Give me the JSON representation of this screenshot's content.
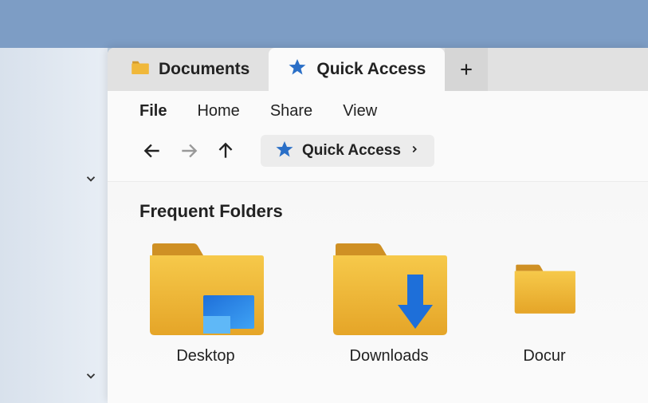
{
  "tabs": [
    {
      "label": "Documents",
      "active": false
    },
    {
      "label": "Quick Access",
      "active": true
    }
  ],
  "menu": {
    "file": "File",
    "home": "Home",
    "share": "Share",
    "view": "View"
  },
  "breadcrumb": {
    "current": "Quick Access"
  },
  "section": {
    "title": "Frequent Folders"
  },
  "folders": [
    {
      "label": "Desktop",
      "overlay": "desktop"
    },
    {
      "label": "Downloads",
      "overlay": "downloads"
    },
    {
      "label": "Docur",
      "overlay": "none"
    }
  ]
}
